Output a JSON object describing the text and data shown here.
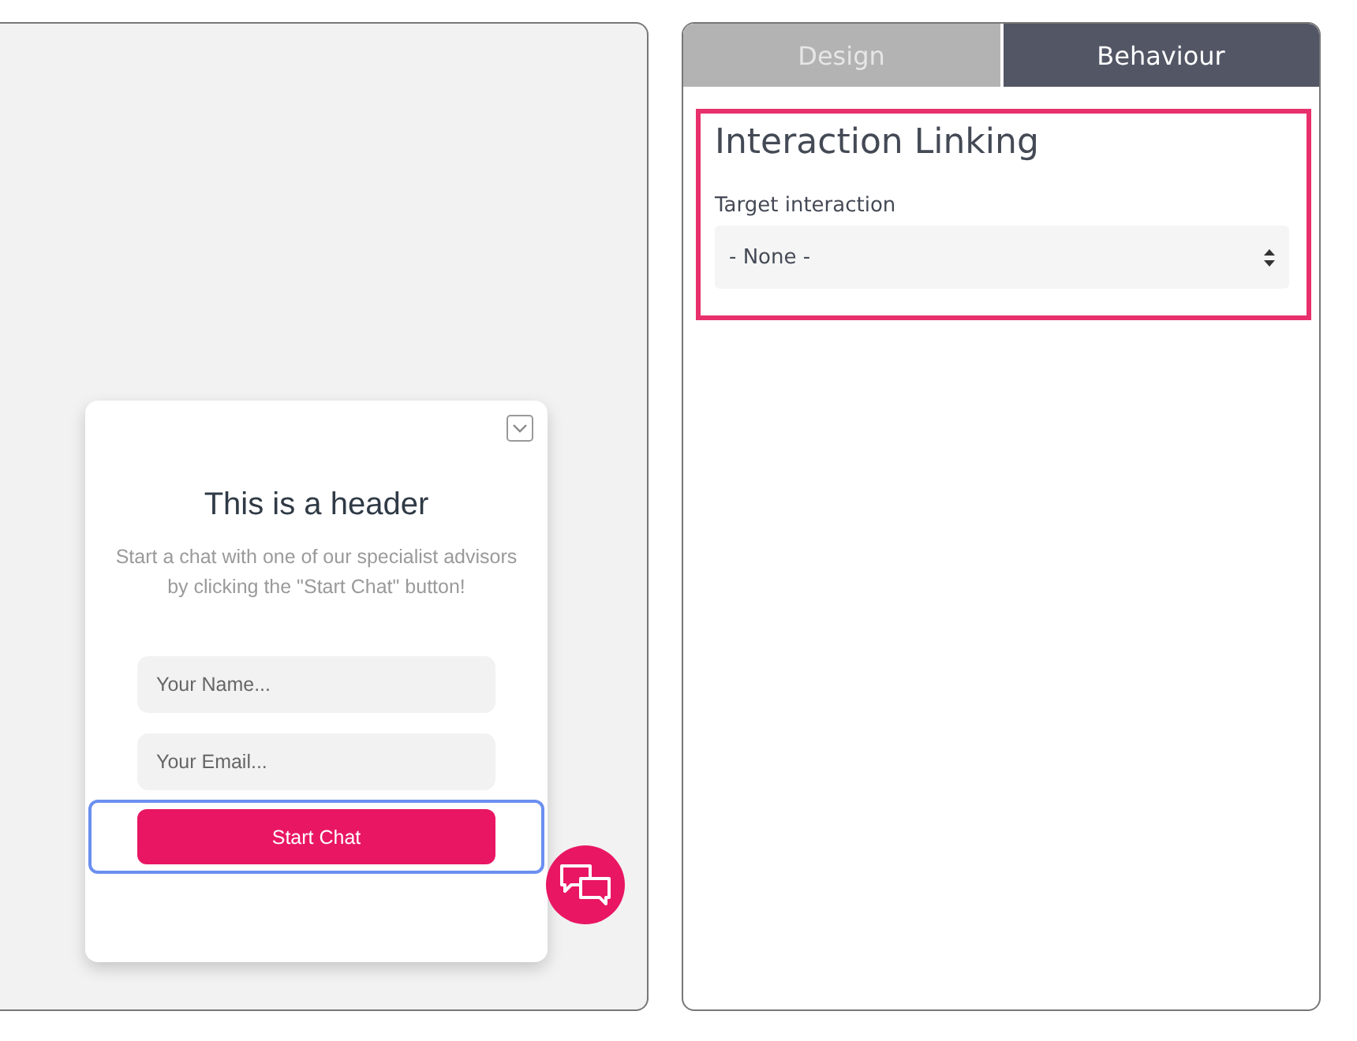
{
  "preview": {
    "widget": {
      "header": "This is a header",
      "description": "Start a chat with one of our specialist advisors by clicking the \"Start Chat\" button!",
      "fields": [
        {
          "placeholder": "Your Name..."
        },
        {
          "placeholder": "Your Email..."
        }
      ],
      "button": {
        "label": "Start Chat",
        "focused": true
      }
    }
  },
  "settings": {
    "tabs": [
      {
        "label": "Design",
        "selected": false
      },
      {
        "label": "Behaviour",
        "selected": true
      }
    ],
    "section": {
      "title": "Interaction Linking",
      "highlighted": true,
      "field_label": "Target interaction",
      "select_value": "- None -"
    }
  }
}
